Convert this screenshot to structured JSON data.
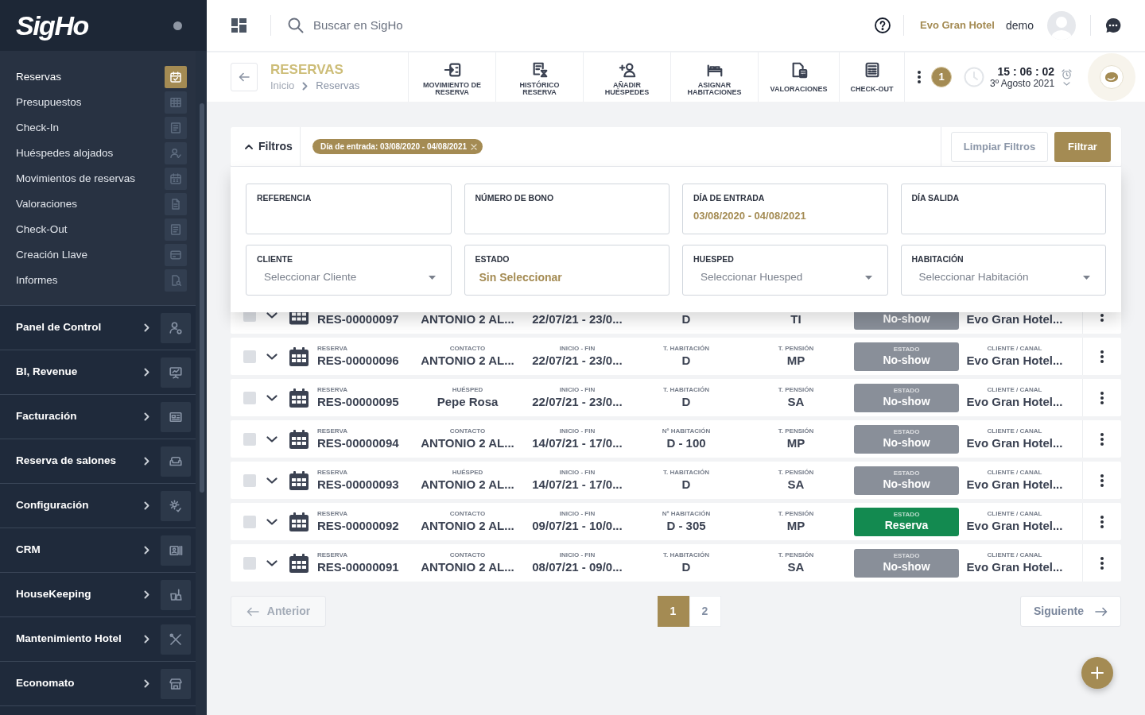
{
  "sidebar": {
    "logo": "SigHo",
    "menu": [
      {
        "label": "Reservas",
        "selected": true
      },
      {
        "label": "Presupuestos",
        "selected": false
      },
      {
        "label": "Check-In",
        "selected": false
      },
      {
        "label": "Huéspedes alojados",
        "selected": false
      },
      {
        "label": "Movimientos de reservas",
        "selected": false
      },
      {
        "label": "Valoraciones",
        "selected": false
      },
      {
        "label": "Check-Out",
        "selected": false
      },
      {
        "label": "Creación Llave",
        "selected": false
      },
      {
        "label": "Informes",
        "selected": false
      }
    ],
    "sections": [
      {
        "label": "Panel de Control"
      },
      {
        "label": "BI, Revenue"
      },
      {
        "label": "Facturación"
      },
      {
        "label": "Reserva de salones"
      },
      {
        "label": "Configuración"
      },
      {
        "label": "CRM"
      },
      {
        "label": "HouseKeeping"
      },
      {
        "label": "Mantenimiento Hotel"
      },
      {
        "label": "Economato"
      }
    ]
  },
  "header": {
    "search": {
      "placeholder": "Buscar en SigHo"
    },
    "hotel": "Evo Gran Hotel",
    "user": "demo"
  },
  "page": {
    "title": "RESERVAS",
    "breadcrumbs": [
      "Inicio",
      "Reservas"
    ]
  },
  "toolbar": [
    {
      "label": "MOVIMIENTO DE RESERVA"
    },
    {
      "label": "HISTÓRICO RESERVA"
    },
    {
      "label": "AÑADIR HUÉSPEDES"
    },
    {
      "label": "ASIGNAR HABITACIONES"
    },
    {
      "label": "VALORACIONES"
    },
    {
      "label": "CHECK-OUT"
    }
  ],
  "status_area": {
    "notifications": "1",
    "time": "15 : 06 : 02",
    "date": "3º Agosto 2021"
  },
  "filters": {
    "label": "Filtros",
    "expanded": true,
    "chips": [
      {
        "label": "Día de entrada: 03/08/2020 - 04/08/2021"
      }
    ],
    "clear_button": "Limpiar Filtros",
    "apply_button": "Filtrar",
    "fields": [
      {
        "kind": "text",
        "label": "REFERENCIA"
      },
      {
        "kind": "text",
        "label": "NÚMERO DE BONO"
      },
      {
        "kind": "text",
        "label": "DÍA DE ENTRADA",
        "value": "03/08/2020 - 04/08/2021"
      },
      {
        "kind": "text",
        "label": "DÍA SALIDA"
      },
      {
        "kind": "select",
        "label": "CLIENTE",
        "placeholder": "Seleccionar Cliente"
      },
      {
        "kind": "multiselect",
        "label": "ESTADO",
        "value": "Sin Seleccionar"
      },
      {
        "kind": "select",
        "label": "HUESPED",
        "placeholder": "Seleccionar Huesped"
      },
      {
        "kind": "select",
        "label": "HABITACIÓN",
        "placeholder": "Seleccionar Habitación"
      }
    ]
  },
  "reservations": [
    {
      "checked": false,
      "expanded": false,
      "reference": {
        "value": "RES-00000097"
      },
      "person": {
        "value": "ANTONIO 2 AL..."
      },
      "dates": {
        "value": "22/07/21 - 23/0..."
      },
      "room": {
        "value": "D"
      },
      "board": {
        "value": "TI"
      },
      "status": {
        "value": "No-show",
        "color": "#898f99"
      },
      "channel": {
        "value": "Evo Gran Hotel..."
      }
    },
    {
      "checked": false,
      "expanded": false,
      "reference": {
        "label": "RESERVA",
        "value": "RES-00000096"
      },
      "person": {
        "label": "CONTACTO",
        "value": "ANTONIO 2 AL..."
      },
      "dates": {
        "label": "INICIO - FIN",
        "value": "22/07/21 - 23/0..."
      },
      "room": {
        "label": "T. HABITACIÓN",
        "value": "D"
      },
      "board": {
        "label": "T. PENSIÓN",
        "value": "MP"
      },
      "status": {
        "label": "ESTADO",
        "value": "No-show",
        "color": "#898f99"
      },
      "channel": {
        "label": "CLIENTE / CANAL",
        "value": "Evo Gran Hotel..."
      }
    },
    {
      "checked": false,
      "expanded": false,
      "reference": {
        "label": "RESERVA",
        "value": "RES-00000095"
      },
      "person": {
        "label": "HUÉSPED",
        "value": "Pepe Rosa"
      },
      "dates": {
        "label": "INICIO - FIN",
        "value": "22/07/21 - 23/0..."
      },
      "room": {
        "label": "T. HABITACIÓN",
        "value": "D"
      },
      "board": {
        "label": "T. PENSIÓN",
        "value": "SA"
      },
      "status": {
        "label": "ESTADO",
        "value": "No-show",
        "color": "#898f99"
      },
      "channel": {
        "label": "CLIENTE / CANAL",
        "value": "Evo Gran Hotel..."
      }
    },
    {
      "checked": false,
      "expanded": false,
      "reference": {
        "label": "RESERVA",
        "value": "RES-00000094"
      },
      "person": {
        "label": "CONTACTO",
        "value": "ANTONIO 2 AL..."
      },
      "dates": {
        "label": "INICIO - FIN",
        "value": "14/07/21 - 17/0..."
      },
      "room": {
        "label": "Nº HABITACIÓN",
        "value": "D - 100"
      },
      "board": {
        "label": "T. PENSIÓN",
        "value": "MP"
      },
      "status": {
        "label": "ESTADO",
        "value": "No-show",
        "color": "#898f99"
      },
      "channel": {
        "label": "CLIENTE / CANAL",
        "value": "Evo Gran Hotel..."
      }
    },
    {
      "checked": false,
      "expanded": false,
      "reference": {
        "label": "RESERVA",
        "value": "RES-00000093"
      },
      "person": {
        "label": "HUÉSPED",
        "value": "ANTONIO 2 AL..."
      },
      "dates": {
        "label": "INICIO - FIN",
        "value": "14/07/21 - 17/0..."
      },
      "room": {
        "label": "T. HABITACIÓN",
        "value": "D"
      },
      "board": {
        "label": "T. PENSIÓN",
        "value": "SA"
      },
      "status": {
        "label": "ESTADO",
        "value": "No-show",
        "color": "#898f99"
      },
      "channel": {
        "label": "CLIENTE / CANAL",
        "value": "Evo Gran Hotel..."
      }
    },
    {
      "checked": false,
      "expanded": false,
      "reference": {
        "label": "RESERVA",
        "value": "RES-00000092"
      },
      "person": {
        "label": "CONTACTO",
        "value": "ANTONIO 2 AL..."
      },
      "dates": {
        "label": "INICIO - FIN",
        "value": "09/07/21 - 10/0..."
      },
      "room": {
        "label": "Nº HABITACIÓN",
        "value": "D - 305"
      },
      "board": {
        "label": "T. PENSIÓN",
        "value": "MP"
      },
      "status": {
        "label": "ESTADO",
        "value": "Reserva",
        "color": "#138a50"
      },
      "channel": {
        "label": "CLIENTE / CANAL",
        "value": "Evo Gran Hotel..."
      }
    },
    {
      "checked": false,
      "expanded": false,
      "reference": {
        "label": "RESERVA",
        "value": "RES-00000091"
      },
      "person": {
        "label": "CONTACTO",
        "value": "ANTONIO 2 AL..."
      },
      "dates": {
        "label": "INICIO - FIN",
        "value": "08/07/21 - 09/0..."
      },
      "room": {
        "label": "T. HABITACIÓN",
        "value": "D"
      },
      "board": {
        "label": "T. PENSIÓN",
        "value": "SA"
      },
      "status": {
        "label": "ESTADO",
        "value": "No-show",
        "color": "#898f99"
      },
      "channel": {
        "label": "CLIENTE / CANAL",
        "value": "Evo Gran Hotel..."
      }
    }
  ],
  "pagination": {
    "previous": {
      "label": "Anterior",
      "disabled": true
    },
    "pages": [
      {
        "label": "1",
        "selected": true
      },
      {
        "label": "2",
        "selected": false
      }
    ],
    "next": {
      "label": "Siguiente",
      "disabled": false
    }
  }
}
